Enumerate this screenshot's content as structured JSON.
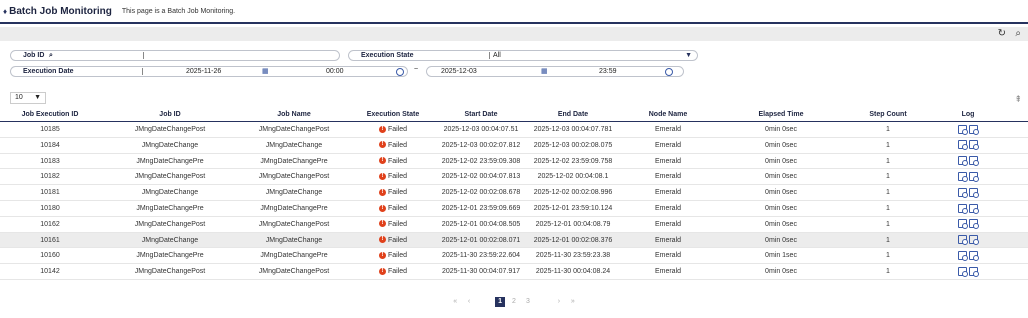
{
  "header": {
    "title": "Batch Job Monitoring",
    "subtitle": "This page is a Batch Job Monitoring."
  },
  "search": {
    "job_id_label": "Job ID",
    "job_id_value": "",
    "exec_state_label": "Execution State",
    "exec_state_value": "All",
    "exec_date_label": "Execution Date",
    "start_date": "2025-11-26",
    "start_time": "00:00",
    "range_sep": "~",
    "end_date": "2025-12-03",
    "end_time": "23:59"
  },
  "page_size": "10",
  "columns": [
    "Job Execution ID",
    "Job ID",
    "Job Name",
    "Execution State",
    "Start Date",
    "End Date",
    "Node Name",
    "Elapsed Time",
    "Step Count",
    "Log"
  ],
  "rows": [
    {
      "id": "10185",
      "job_id": "JMngDateChangePost",
      "job_name": "JMngDateChangePost",
      "state": "Failed",
      "start": "2025-12-03 00:04:07.51",
      "end": "2025-12-03 00:04:07.781",
      "node": "Emerald",
      "elapsed": "0min 0sec",
      "steps": "1"
    },
    {
      "id": "10184",
      "job_id": "JMngDateChange",
      "job_name": "JMngDateChange",
      "state": "Failed",
      "start": "2025-12-03 00:02:07.812",
      "end": "2025-12-03 00:02:08.075",
      "node": "Emerald",
      "elapsed": "0min 0sec",
      "steps": "1"
    },
    {
      "id": "10183",
      "job_id": "JMngDateChangePre",
      "job_name": "JMngDateChangePre",
      "state": "Failed",
      "start": "2025-12-02 23:59:09.308",
      "end": "2025-12-02 23:59:09.758",
      "node": "Emerald",
      "elapsed": "0min 0sec",
      "steps": "1"
    },
    {
      "id": "10182",
      "job_id": "JMngDateChangePost",
      "job_name": "JMngDateChangePost",
      "state": "Failed",
      "start": "2025-12-02 00:04:07.813",
      "end": "2025-12-02 00:04:08.1",
      "node": "Emerald",
      "elapsed": "0min 0sec",
      "steps": "1"
    },
    {
      "id": "10181",
      "job_id": "JMngDateChange",
      "job_name": "JMngDateChange",
      "state": "Failed",
      "start": "2025-12-02 00:02:08.678",
      "end": "2025-12-02 00:02:08.996",
      "node": "Emerald",
      "elapsed": "0min 0sec",
      "steps": "1"
    },
    {
      "id": "10180",
      "job_id": "JMngDateChangePre",
      "job_name": "JMngDateChangePre",
      "state": "Failed",
      "start": "2025-12-01 23:59:09.669",
      "end": "2025-12-01 23:59:10.124",
      "node": "Emerald",
      "elapsed": "0min 0sec",
      "steps": "1"
    },
    {
      "id": "10162",
      "job_id": "JMngDateChangePost",
      "job_name": "JMngDateChangePost",
      "state": "Failed",
      "start": "2025-12-01 00:04:08.505",
      "end": "2025-12-01 00:04:08.79",
      "node": "Emerald",
      "elapsed": "0min 0sec",
      "steps": "1"
    },
    {
      "id": "10161",
      "job_id": "JMngDateChange",
      "job_name": "JMngDateChange",
      "state": "Failed",
      "start": "2025-12-01 00:02:08.071",
      "end": "2025-12-01 00:02:08.376",
      "node": "Emerald",
      "elapsed": "0min 0sec",
      "steps": "1"
    },
    {
      "id": "10160",
      "job_id": "JMngDateChangePre",
      "job_name": "JMngDateChangePre",
      "state": "Failed",
      "start": "2025-11-30 23:59:22.604",
      "end": "2025-11-30 23:59:23.38",
      "node": "Emerald",
      "elapsed": "0min 1sec",
      "steps": "1"
    },
    {
      "id": "10142",
      "job_id": "JMngDateChangePost",
      "job_name": "JMngDateChangePost",
      "state": "Failed",
      "start": "2025-11-30 00:04:07.917",
      "end": "2025-11-30 00:04:08.24",
      "node": "Emerald",
      "elapsed": "0min 0sec",
      "steps": "1"
    }
  ],
  "pager": {
    "first": "«",
    "prev": "‹",
    "pages": [
      "1",
      "2",
      "3"
    ],
    "next": "›",
    "last": "»"
  },
  "colors": {
    "accent": "#26325e",
    "failed": "#e0411b"
  }
}
